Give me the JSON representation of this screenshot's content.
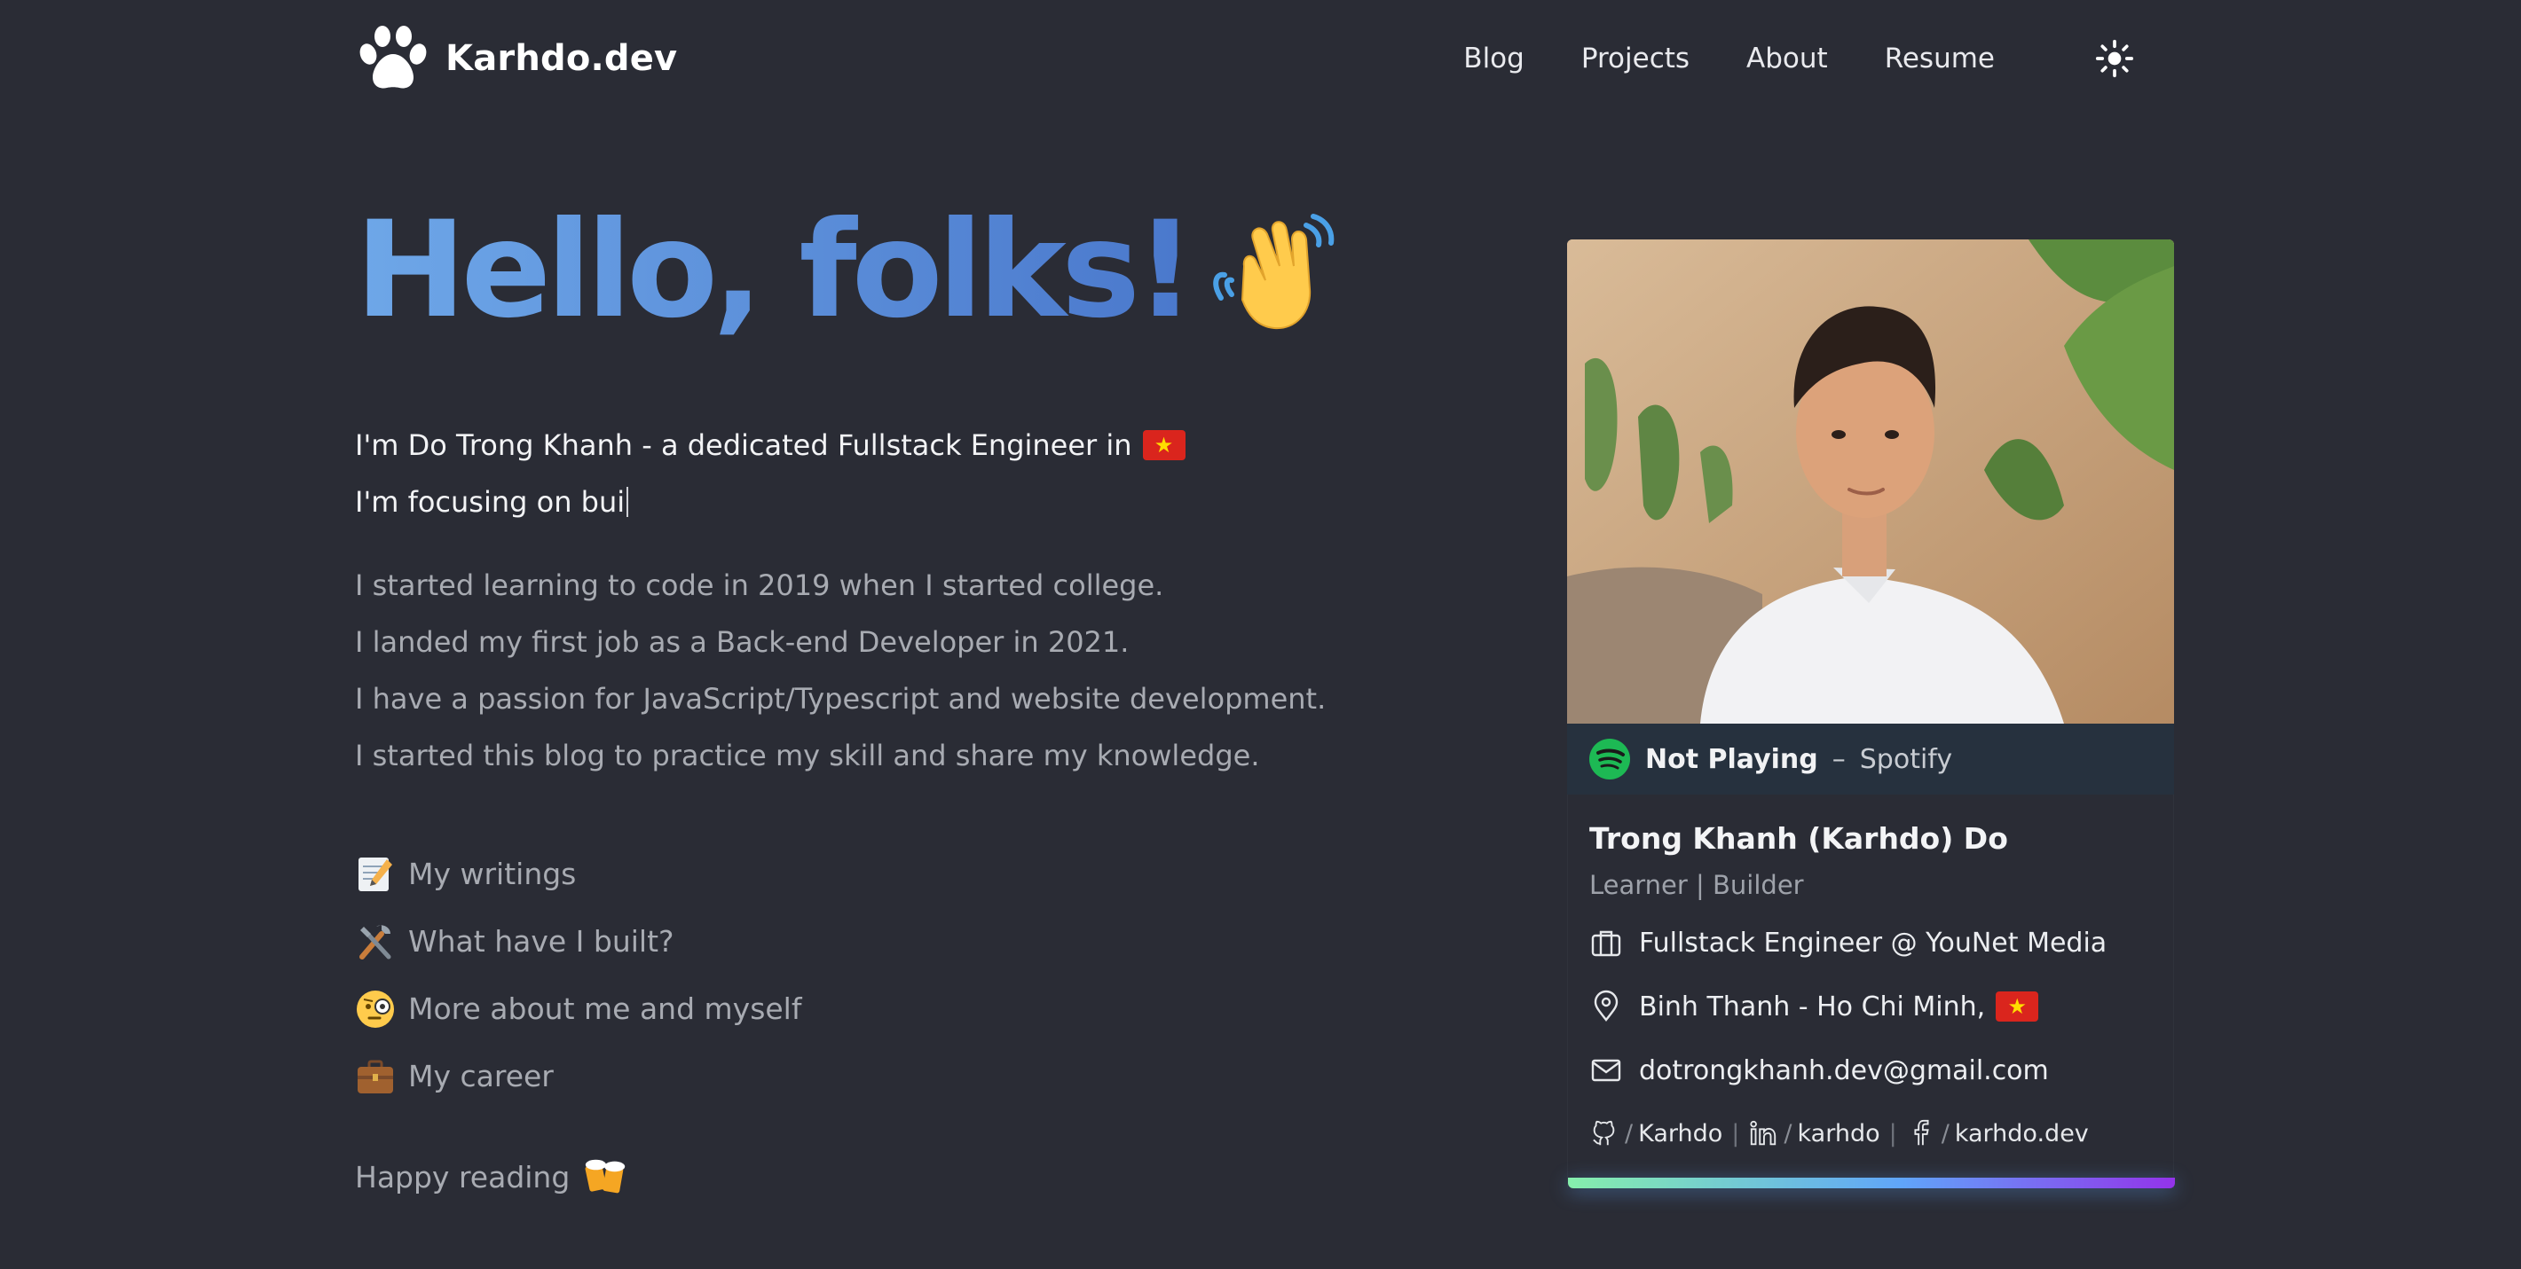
{
  "nav": {
    "brand": "Karhdo.dev",
    "items": [
      {
        "label": "Blog"
      },
      {
        "label": "Projects"
      },
      {
        "label": "About"
      },
      {
        "label": "Resume"
      }
    ],
    "theme_icon": "sun-icon"
  },
  "hero": {
    "title": "Hello, folks!",
    "emoji": "waving-hand-emoji"
  },
  "intro": {
    "line1": "I'm Do Trong Khanh - a dedicated Fullstack Engineer in",
    "line2": "I'm focusing on bui"
  },
  "story": [
    "I started learning to code in 2019 when I started college.",
    "I landed my first job as a Back-end Developer in 2021.",
    "I have a passion for JavaScript/Typescript and website development.",
    "I started this blog to practice my skill and share my knowledge."
  ],
  "links": [
    {
      "label": "My writings",
      "icon": "memo-emoji"
    },
    {
      "label": "What have I built?",
      "icon": "tools-emoji"
    },
    {
      "label": "More about me and myself",
      "icon": "monocle-face-emoji"
    },
    {
      "label": "My career",
      "icon": "briefcase-emoji"
    }
  ],
  "footer_note": {
    "label": "Happy reading",
    "icon": "beer-mugs-emoji"
  },
  "card": {
    "spotify": {
      "status": "Not Playing",
      "separator": "–",
      "source": "Spotify"
    },
    "name": "Trong Khanh (Karhdo) Do",
    "role": "Learner | Builder",
    "job": "Fullstack Engineer @ YouNet Media",
    "location": "Binh Thanh - Ho Chi Minh,",
    "email": "dotrongkhanh.dev@gmail.com",
    "social": [
      {
        "icon": "github-icon",
        "handle": "Karhdo"
      },
      {
        "icon": "linkedin-icon",
        "handle": "karhdo"
      },
      {
        "icon": "facebook-icon",
        "handle": "karhdo.dev"
      }
    ]
  },
  "colors": {
    "background": "#2a2c35",
    "accent": "#4a78cc",
    "spotify_green": "#1db954"
  }
}
